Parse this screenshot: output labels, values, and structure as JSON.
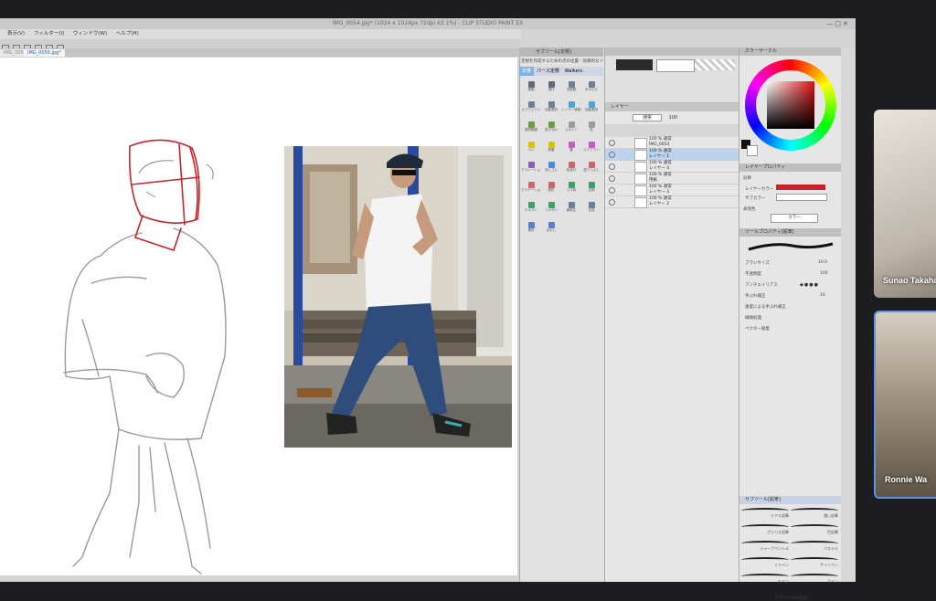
{
  "window": {
    "title": "IMG_0054.jpg* (1024 x 1024px 72dpi 63.1%) - CLIP STUDIO PAINT EX",
    "controls": "—  □  ✕"
  },
  "menu": [
    "表示(V)",
    "フィルター(I)",
    "ウィンドウ(W)",
    "ヘルプ(H)"
  ],
  "tabs": [
    "IMG_0054.jpg*",
    "IMG_0056.jpg*"
  ],
  "subtool_panel": {
    "header": "サブツール[定規]",
    "current": "定規を作成するための点の位置 - 効果的なツール",
    "tabs": [
      "定規",
      "パース定規",
      "Walkers"
    ],
    "tools": [
      {
        "label": "移動",
        "color": "#5d6b7d"
      },
      {
        "label": "操作",
        "color": "#5d6b7d"
      },
      {
        "label": "虫眼鏡",
        "color": "#6d7f92"
      },
      {
        "label": "手のひら",
        "color": "#6d7f92"
      },
      {
        "label": "オブジェクト",
        "color": "#6d7f92"
      },
      {
        "label": "自動選択",
        "color": "#6d7f92"
      },
      {
        "label": "レイヤー移動",
        "color": "#4aa6da"
      },
      {
        "label": "自動選択",
        "color": "#4aa6da"
      },
      {
        "label": "選択範囲",
        "color": "#6b9e3b"
      },
      {
        "label": "投げなわ",
        "color": "#6b9e3b"
      },
      {
        "label": "スポイト",
        "color": "#9b9b9b"
      },
      {
        "label": "色",
        "color": "#9b9b9b"
      },
      {
        "label": "ペン",
        "color": "#d6c400"
      },
      {
        "label": "鉛筆",
        "color": "#d6c400"
      },
      {
        "label": "筆",
        "color": "#c95cc3"
      },
      {
        "label": "エアブラシ",
        "color": "#c95cc3"
      },
      {
        "label": "デコレーション",
        "color": "#8a5fb7"
      },
      {
        "label": "消しゴム",
        "color": "#4a8bd9"
      },
      {
        "label": "色混ぜ",
        "color": "#d16464"
      },
      {
        "label": "塗りつぶし",
        "color": "#d16464"
      },
      {
        "label": "グラデーション",
        "color": "#d16464"
      },
      {
        "label": "図形",
        "color": "#d16464"
      },
      {
        "label": "コマ枠",
        "color": "#3fa06a"
      },
      {
        "label": "定規",
        "color": "#3fa06a"
      },
      {
        "label": "テキスト",
        "color": "#3fa06a"
      },
      {
        "label": "フキダシ",
        "color": "#3fa06a"
      },
      {
        "label": "線修正",
        "color": "#6b7e99"
      },
      {
        "label": "合成",
        "color": "#6b7e99"
      },
      {
        "label": "素材",
        "color": "#5a7fcf"
      },
      {
        "label": "ぼかし",
        "color": "#5a7fcf"
      }
    ]
  },
  "layer_panel": {
    "header": "レイヤー",
    "blend": "通常",
    "opacity": "100",
    "layers": [
      {
        "name": "100 % 通常",
        "sub": "IMG_0054",
        "selected": false
      },
      {
        "name": "100 % 通常",
        "sub": "レイヤー 1",
        "selected": true
      },
      {
        "name": "100 % 通常",
        "sub": "レイヤー 4",
        "selected": false
      },
      {
        "name": "100 % 通常",
        "sub": "用紙",
        "selected": false
      },
      {
        "name": "100 % 通常",
        "sub": "レイヤー 3",
        "selected": false
      },
      {
        "name": "100 % 通常",
        "sub": "レイヤー 2",
        "selected": false
      }
    ]
  },
  "color_panel": {
    "header": "カラーサークル",
    "prop_header": "レイヤープロパティ",
    "prop_items": [
      "効果",
      "レイヤーカラー",
      "サブカラー",
      "表現色"
    ],
    "expression": "カラー",
    "brush_header": "ツールプロパティ[鉛筆]",
    "brush_size_label": "ブラシサイズ",
    "brush_size": "10.0",
    "opacity_label": "不透明度",
    "opacity": "100",
    "antialias_label": "アンチエイリアス",
    "options": [
      "手ぶれ補正",
      "速度による手ぶれ補正",
      "線端処理",
      "ベクター吸着"
    ],
    "stabilize": "10",
    "subtool_header": "サブツール[鉛筆]",
    "pencils": [
      "リアル鉛筆",
      "濃い鉛筆",
      "ざらつき鉛筆",
      "色鉛筆",
      "シャープペンシル",
      "パステル",
      "ミリペン",
      "サインペン",
      "丸ペン",
      "Gペン"
    ],
    "add_label": "サブツールの追加"
  },
  "participants": [
    {
      "name": "Sunao Takahashi"
    },
    {
      "name": "Ronnie Wa"
    }
  ],
  "colors": {
    "ui_bg": "#d4d4d4",
    "accent": "#4a9be0",
    "sketch_red": "#c8242b",
    "video_border": "#5b94e8"
  }
}
